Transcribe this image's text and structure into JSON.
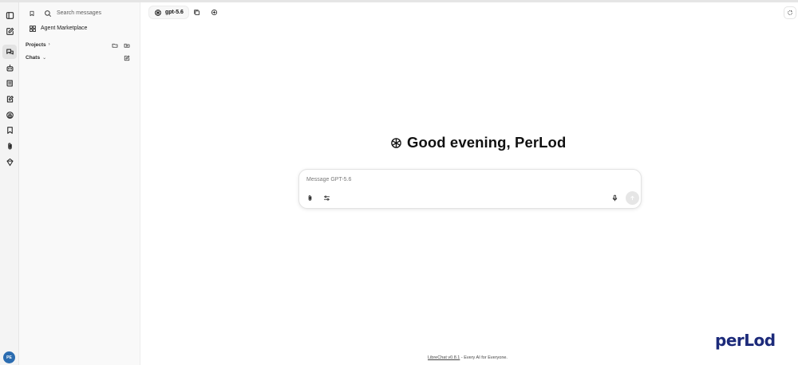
{
  "sidebar": {
    "search_label": "Search messages",
    "marketplace_label": "Agent Marketplace",
    "projects_label": "Projects",
    "chats_label": "Chats"
  },
  "rail": {
    "icons": [
      "sidebar-toggle-icon",
      "new-chat-icon",
      "chats-icon",
      "agents-icon",
      "prompts-icon",
      "memories-icon",
      "mcp-icon",
      "bookmarks-icon",
      "attachments-icon",
      "model-icon"
    ],
    "avatar_initials": "PE"
  },
  "header": {
    "model_name": "gpt-5.6"
  },
  "greeting": {
    "text": "Good evening, PerLod"
  },
  "composer": {
    "placeholder": "Message GPT-5.6",
    "value": ""
  },
  "footer": {
    "link_text": "LibreChat v0.8.1",
    "tagline": " - Every AI for Everyone."
  },
  "brand": {
    "text": "perLod",
    "color": "#1c2a7a"
  }
}
